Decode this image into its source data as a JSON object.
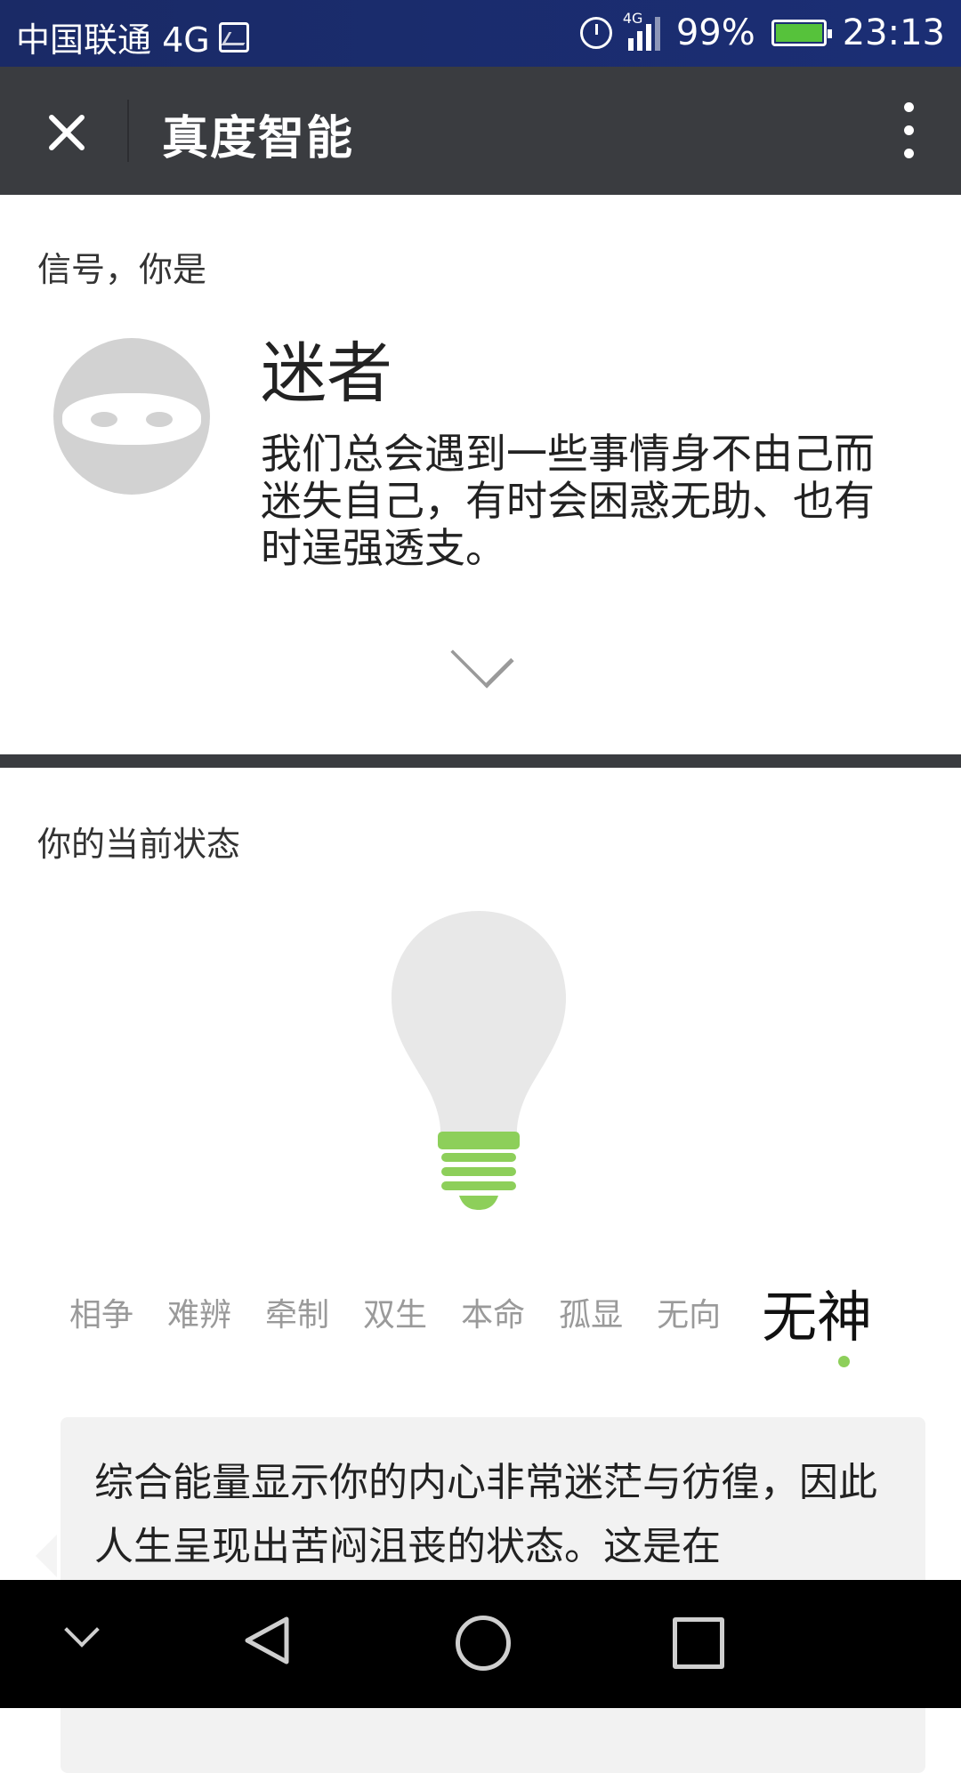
{
  "status_bar": {
    "carrier": "中国联通 4G",
    "network_badge": "4G",
    "battery": "99%",
    "time": "23:13"
  },
  "app_bar": {
    "title": "真度智能"
  },
  "identity": {
    "label": "信号，你是",
    "type": "迷者",
    "description": "我们总会遇到一些事情身不由己而迷失自己，有时会困惑无助、也有时逞强透支。"
  },
  "current_state": {
    "label": "你的当前状态",
    "states": [
      "相争",
      "难辨",
      "牵制",
      "双生",
      "本命",
      "孤显",
      "无向"
    ],
    "active_state": "无神",
    "description": "综合能量显示你的内心非常迷茫与彷徨，因此人生呈现出苦闷沮丧的状态。这是在"
  },
  "colors": {
    "status_bar": "#1b2e75",
    "app_bar": "#3a3c40",
    "accent_green": "#8dcf5a",
    "card_bg": "#f2f2f2"
  },
  "icons": {
    "close": "close-icon",
    "more": "more-vertical-icon",
    "expand": "chevron-down-icon",
    "bulb": "light-bulb-icon",
    "nav_down": "chevron-down-icon",
    "nav_back": "back-triangle-icon",
    "nav_home": "home-circle-icon",
    "nav_recent": "recent-square-icon"
  }
}
